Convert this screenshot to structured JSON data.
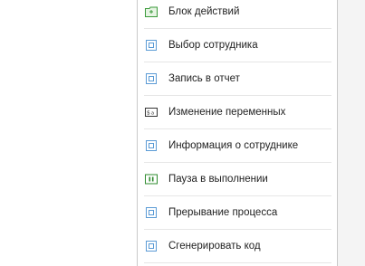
{
  "menu": {
    "items": [
      {
        "label": "Блок действий",
        "icon": "folder-block-icon"
      },
      {
        "label": "Выбор сотрудника",
        "icon": "component-icon"
      },
      {
        "label": "Запись в отчет",
        "icon": "component-icon"
      },
      {
        "label": "Изменение переменных",
        "icon": "variable-change-icon"
      },
      {
        "label": "Информация о сотруднике",
        "icon": "component-icon"
      },
      {
        "label": "Пауза в выполнении",
        "icon": "pause-icon"
      },
      {
        "label": "Прерывание процесса",
        "icon": "component-icon"
      },
      {
        "label": "Сгенерировать код",
        "icon": "component-icon"
      }
    ]
  },
  "colors": {
    "component_icon": "#5b9bd5",
    "folder_icon": "#3a9a3a",
    "pause_icon": "#2e8b2e",
    "variable_icon": "#333333"
  }
}
